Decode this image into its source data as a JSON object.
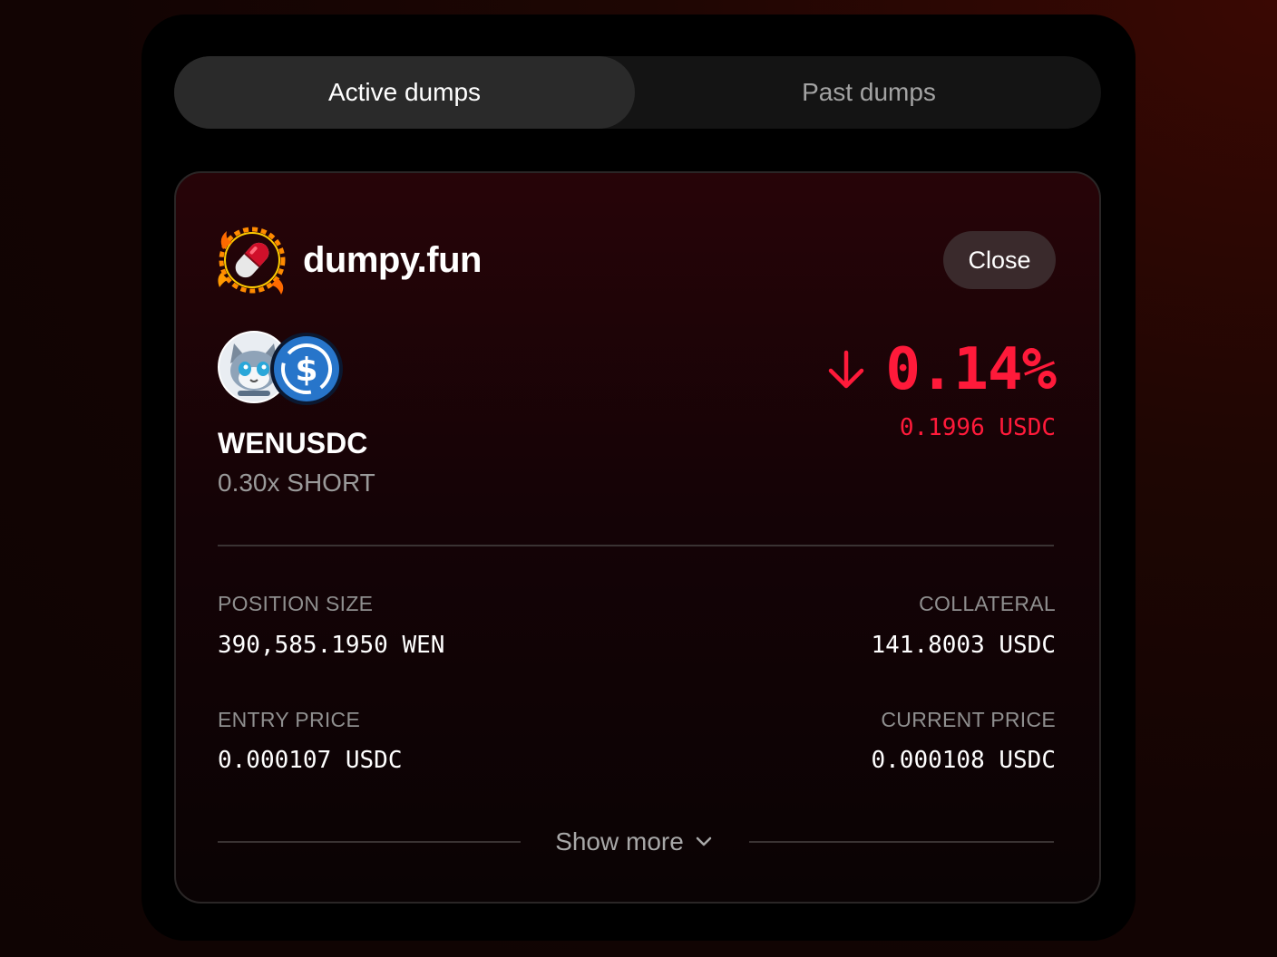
{
  "tabs": {
    "active_label": "Active dumps",
    "past_label": "Past dumps"
  },
  "brand": {
    "name": "dumpy.fun",
    "logo_icon": "flaming-pill-logo"
  },
  "close_button": {
    "label": "Close"
  },
  "position": {
    "pair": "WENUSDC",
    "leverage": "0.30x SHORT",
    "token_icons": [
      "wen-cat-token-icon",
      "usdc-token-icon"
    ],
    "pnl_percent": "0.14%",
    "pnl_amount": "0.1996 USDC",
    "pnl_direction": "down",
    "pnl_color": "#ff1a3a"
  },
  "stats": {
    "position_size": {
      "label": "POSITION SIZE",
      "value": "390,585.1950 WEN"
    },
    "collateral": {
      "label": "COLLATERAL",
      "value": "141.8003 USDC"
    },
    "entry_price": {
      "label": "ENTRY PRICE",
      "value": "0.000107 USDC"
    },
    "current_price": {
      "label": "CURRENT PRICE",
      "value": "0.000108 USDC"
    }
  },
  "show_more": {
    "label": "Show more"
  }
}
